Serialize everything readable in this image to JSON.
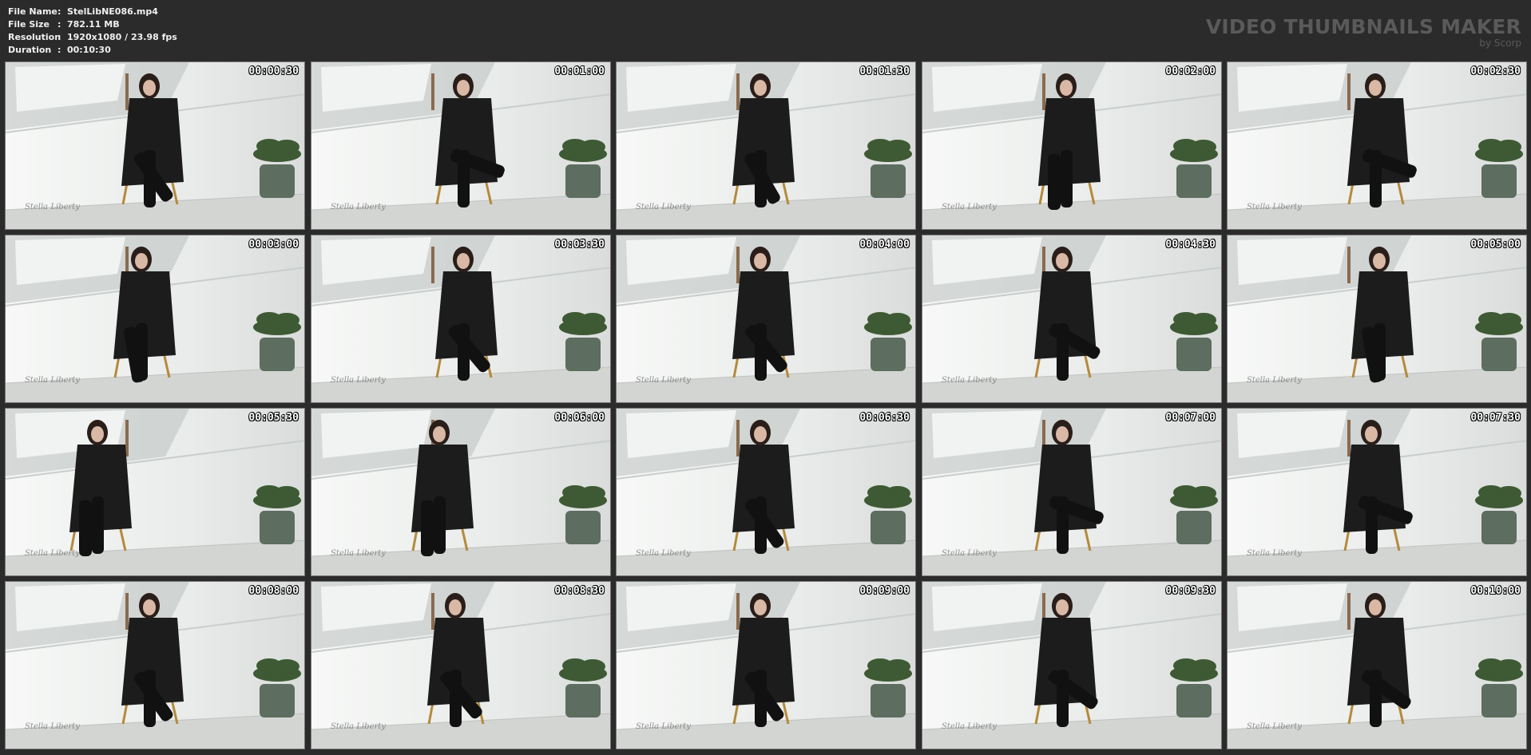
{
  "header": {
    "info": [
      {
        "key": "File Name",
        "sep": ":",
        "value": "StelLibNE086.mp4"
      },
      {
        "key": "File Size",
        "sep": ":",
        "value": "782.11 MB"
      },
      {
        "key": "Resolution",
        "sep": ":",
        "value": "1920x1080 / 23.98 fps"
      },
      {
        "key": "Duration",
        "sep": ":",
        "value": "00:10:30"
      }
    ],
    "brand_title": "VIDEO THUMBNAILS MAKER",
    "brand_sub": "by Scorp"
  },
  "watermark": "Stella Liberty",
  "thumbnails": [
    {
      "timestamp": "00:00:30"
    },
    {
      "timestamp": "00:01:00"
    },
    {
      "timestamp": "00:01:30"
    },
    {
      "timestamp": "00:02:00"
    },
    {
      "timestamp": "00:02:30"
    },
    {
      "timestamp": "00:03:00"
    },
    {
      "timestamp": "00:03:30"
    },
    {
      "timestamp": "00:04:00"
    },
    {
      "timestamp": "00:04:30"
    },
    {
      "timestamp": "00:05:00"
    },
    {
      "timestamp": "00:05:30"
    },
    {
      "timestamp": "00:06:00"
    },
    {
      "timestamp": "00:06:30"
    },
    {
      "timestamp": "00:07:00"
    },
    {
      "timestamp": "00:07:30"
    },
    {
      "timestamp": "00:08:00"
    },
    {
      "timestamp": "00:08:30"
    },
    {
      "timestamp": "00:09:00"
    },
    {
      "timestamp": "00:09:30"
    },
    {
      "timestamp": "00:10:00"
    }
  ],
  "colors": {
    "background": "#2b2b2b",
    "wall": "#e9ecea",
    "floor": "#d3d5d3",
    "coat": "#1c1c1c",
    "plant": "#3e5a34",
    "pot": "#5d6d60"
  }
}
